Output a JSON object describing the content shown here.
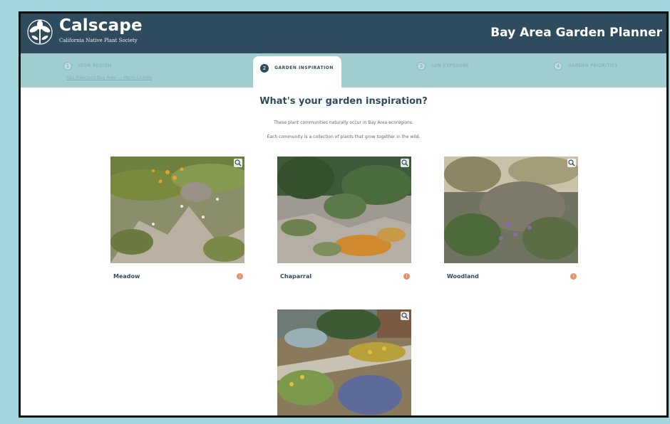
{
  "header": {
    "brand": "Calscape",
    "brand_sub": "California Native Plant Society",
    "title": "Bay Area Garden Planner"
  },
  "steps": [
    {
      "num": "1",
      "label": "YOUR REGION",
      "sub": "San Francisco Bay Area — Marin County"
    },
    {
      "num": "2",
      "label": "GARDEN INSPIRATION"
    },
    {
      "num": "3",
      "label": "SUN EXPOSURE"
    },
    {
      "num": "4",
      "label": "GARDEN PRIORITIES"
    }
  ],
  "main": {
    "heading": "What's your garden inspiration?",
    "desc1": "These plant communities naturally occur in Bay Area ecoregions.",
    "desc2": "Each community is a collection of plants that grow together in the wild."
  },
  "cards": [
    {
      "name": "Meadow",
      "info": "i"
    },
    {
      "name": "Chaparral",
      "info": "i"
    },
    {
      "name": "Woodland",
      "info": "i"
    },
    {
      "name": "",
      "info": ""
    }
  ],
  "colors": {
    "header_bg": "#2f4c5f",
    "steps_bg": "#9fcdd0",
    "accent": "#e4936b",
    "frame_bg": "#a3d6dd"
  },
  "icons": {
    "logo": "poppy-logo-icon",
    "zoom": "zoom-in-icon",
    "info": "info-icon"
  }
}
